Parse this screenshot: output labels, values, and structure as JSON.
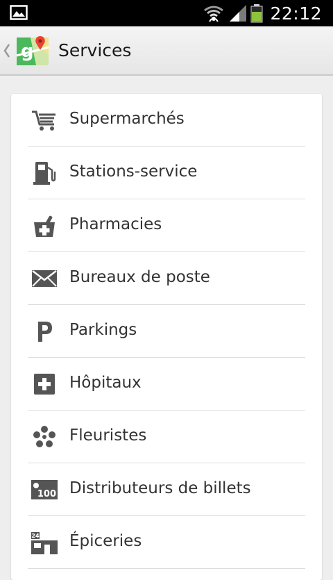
{
  "status_bar": {
    "time": "22:12",
    "icons": [
      "image-notification-icon",
      "wifi-icon",
      "signal-icon",
      "battery-icon"
    ],
    "battery_color": "#8cc43c"
  },
  "action_bar": {
    "title": "Services",
    "logo": "google-maps-logo"
  },
  "items": [
    {
      "label": "Supermarchés",
      "icon": "shopping-cart-icon"
    },
    {
      "label": "Stations-service",
      "icon": "gas-pump-icon"
    },
    {
      "label": "Pharmacies",
      "icon": "pharmacy-icon"
    },
    {
      "label": "Bureaux de poste",
      "icon": "envelope-icon"
    },
    {
      "label": "Parkings",
      "icon": "parking-icon"
    },
    {
      "label": "Hôpitaux",
      "icon": "hospital-cross-icon"
    },
    {
      "label": "Fleuristes",
      "icon": "flower-icon"
    },
    {
      "label": "Distributeurs de billets",
      "icon": "atm-icon",
      "badge": "100"
    },
    {
      "label": "Épiceries",
      "icon": "grocery-store-icon",
      "badge": "24"
    }
  ],
  "colors": {
    "icon_gray": "#555555",
    "text": "#333333",
    "background": "#eeeeee"
  }
}
